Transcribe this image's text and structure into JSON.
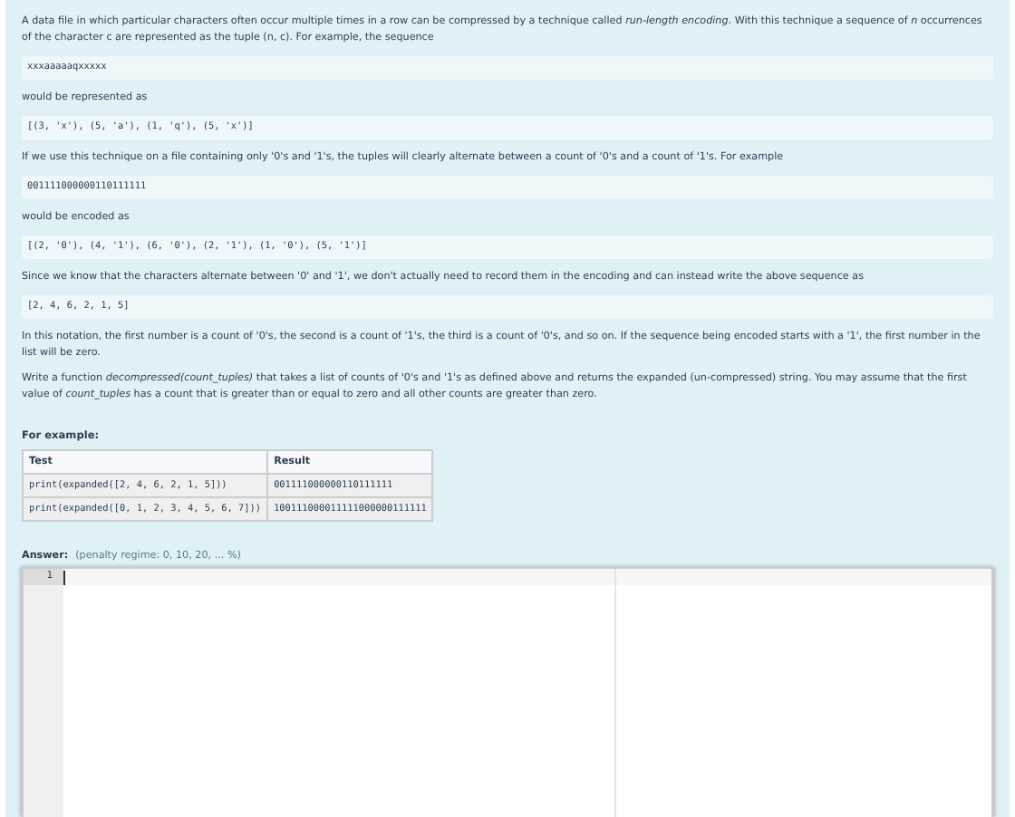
{
  "blocks": [
    {
      "kind": "text",
      "text": "A data file in which particular characters often occur multiple times in a row can be compressed by a technique called *run-length encoding*. With this technique a sequence of  *n* occurrences of the character c are represented as the tuple (n, c). For example, the sequence"
    },
    {
      "kind": "code",
      "text": "xxxaaaaaqxxxxx"
    },
    {
      "kind": "text",
      "text": "would be represented as"
    },
    {
      "kind": "code",
      "text": "[(3, 'x'), (5, 'a'), (1, 'q'), (5, 'x')]"
    },
    {
      "kind": "text",
      "text": "If we use this technique on a file containing only '0's and '1's, the tuples will clearly alternate between a count of '0's and a count of '1's. For example"
    },
    {
      "kind": "code",
      "text": "001111000000110111111"
    },
    {
      "kind": "text",
      "text": "would be encoded as"
    },
    {
      "kind": "code",
      "text": "[(2, '0'), (4, '1'), (6, '0'), (2, '1'), (1, '0'), (5, '1')]"
    },
    {
      "kind": "text",
      "text": "Since we know that the characters alternate between '0' and '1', we don't actually need to record them in the encoding and can instead write the above sequence as"
    },
    {
      "kind": "code",
      "text": "[2, 4, 6, 2, 1, 5]"
    },
    {
      "kind": "text",
      "text": "In this notation, the first number is a count of '0's, the second is a count of '1's, the third is a count of '0's, and so on. If the sequence being encoded starts with a '1', the first number in the list will be zero."
    },
    {
      "kind": "text",
      "text": "Write a function *decompressed(count_tuples)* that takes a list of counts of '0's and '1's as defined above and returns the expanded (un-compressed) string. You may assume that the first value of *count_tuples* has a count that is greater than or equal to zero and all other counts are greater than zero."
    }
  ],
  "example": {
    "heading": "For example:",
    "columns": [
      "Test",
      "Result"
    ],
    "rows": [
      [
        "print(expanded([2, 4, 6, 2, 1, 5]))",
        "001111000000110111111"
      ],
      [
        "print(expanded([0, 1, 2, 3, 4, 5, 6, 7]))",
        "100111000011111000000111111"
      ]
    ]
  },
  "answer": {
    "label": "Answer:",
    "penalty": "(penalty regime: 0, 10, 20, ... %)",
    "line_numbers": [
      "1"
    ]
  }
}
